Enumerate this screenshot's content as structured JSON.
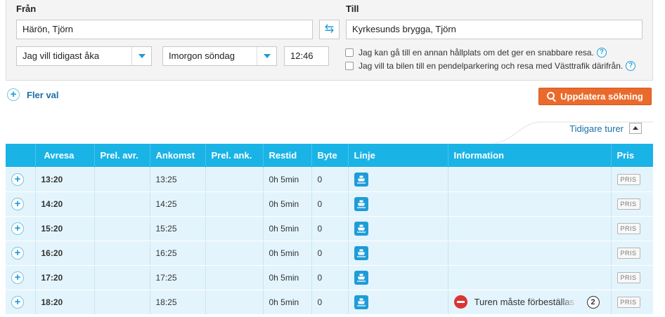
{
  "search": {
    "from_label": "Från",
    "from_value": "Härön, Tjörn",
    "to_label": "Till",
    "to_value": "Kyrkesunds brygga, Tjörn",
    "time_mode": "Jag vill tidigast åka",
    "day": "Imorgon söndag",
    "time": "12:46",
    "option_walk": "Jag kan gå till en annan hållplats om det ger en snabbare resa.",
    "option_park": "Jag vill ta bilen till en pendelparkering och resa med Västtrafik därifrån.",
    "help_glyph": "?",
    "more_options": "Fler val",
    "update_button": "Uppdatera sökning"
  },
  "earlier_trips": "Tidigare turer",
  "table": {
    "headers": {
      "avresa": "Avresa",
      "prel_avr": "Prel. avr.",
      "ankomst": "Ankomst",
      "prel_ank": "Prel. ank.",
      "restid": "Restid",
      "byte": "Byte",
      "linje": "Linje",
      "information": "Information",
      "pris": "Pris"
    },
    "rows": [
      {
        "avresa": "13:20",
        "prel_avr": "",
        "ankomst": "13:25",
        "prel_ank": "",
        "restid": "0h 5min",
        "byte": "0",
        "linje": "ferry-icon",
        "information": "",
        "pris": "PRIS"
      },
      {
        "avresa": "14:20",
        "prel_avr": "",
        "ankomst": "14:25",
        "prel_ank": "",
        "restid": "0h 5min",
        "byte": "0",
        "linje": "ferry-icon",
        "information": "",
        "pris": "PRIS"
      },
      {
        "avresa": "15:20",
        "prel_avr": "",
        "ankomst": "15:25",
        "prel_ank": "",
        "restid": "0h 5min",
        "byte": "0",
        "linje": "ferry-icon",
        "information": "",
        "pris": "PRIS"
      },
      {
        "avresa": "16:20",
        "prel_avr": "",
        "ankomst": "16:25",
        "prel_ank": "",
        "restid": "0h 5min",
        "byte": "0",
        "linje": "ferry-icon",
        "information": "",
        "pris": "PRIS"
      },
      {
        "avresa": "17:20",
        "prel_avr": "",
        "ankomst": "17:25",
        "prel_ank": "",
        "restid": "0h 5min",
        "byte": "0",
        "linje": "ferry-icon",
        "information": "",
        "pris": "PRIS"
      },
      {
        "avresa": "18:20",
        "prel_avr": "",
        "ankomst": "18:25",
        "prel_ank": "",
        "restid": "0h 5min",
        "byte": "0",
        "linje": "ferry-icon",
        "information": "Turen måste förbeställas",
        "info_count": "2",
        "pris": "PRIS"
      }
    ]
  },
  "colors": {
    "header_blue": "#1ab3e6",
    "row_bg": "#e3f4fc",
    "update_orange": "#ea6a2c",
    "link_blue": "#1a6fa8",
    "warning_red": "#dd3333"
  }
}
